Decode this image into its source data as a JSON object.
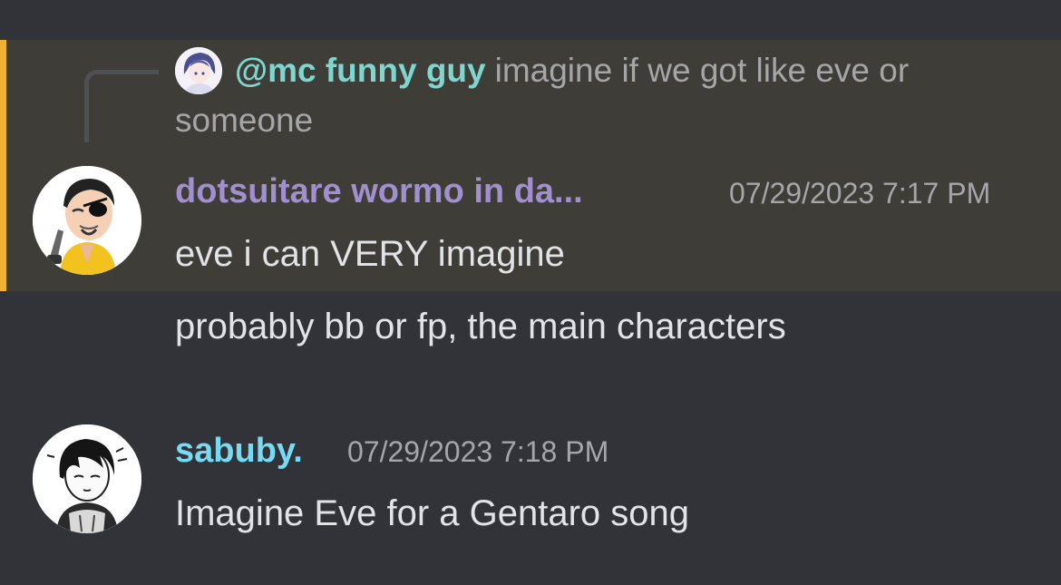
{
  "colors": {
    "background": "#313338",
    "highlight_background": "#3f3d38",
    "highlight_bar": "#f0b232",
    "mention": "#7fd6cf",
    "username_1": "#a18fcf",
    "username_2": "#78d9f2",
    "timestamp": "#a5a6aa",
    "message_text": "#e2e3e6"
  },
  "reply": {
    "mention": "@mc funny guy",
    "text": "imagine if we got like eve or someone",
    "avatar_icon": "anime-avatar-icon"
  },
  "messages": [
    {
      "author": "dotsuitare wormo in da...",
      "timestamp": "07/29/2023 7:17 PM",
      "lines": [
        "eve i can VERY imagine",
        "probably bb or fp, the main characters"
      ],
      "avatar_icon": "eyepatch-man-avatar-icon"
    },
    {
      "author": "sabuby.",
      "timestamp": "07/29/2023 7:18 PM",
      "lines": [
        "Imagine Eve for a Gentaro song"
      ],
      "avatar_icon": "manga-boy-avatar-icon"
    }
  ]
}
